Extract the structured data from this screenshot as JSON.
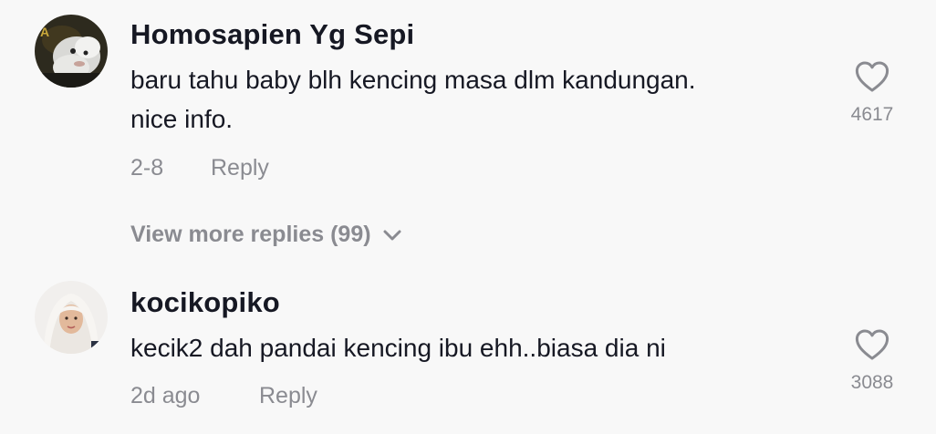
{
  "comments": [
    {
      "username": "Homosapien Yg Sepi",
      "text_lines": [
        "baru tahu baby blh kencing masa dlm kandungan.",
        "nice info."
      ],
      "date": "2-8",
      "reply_label": "Reply",
      "like_count": "4617",
      "avatar_icon": "cat-avatar"
    },
    {
      "username": "kocikopiko",
      "text_lines": [
        "kecik2 dah pandai kencing ibu ehh..biasa dia ni"
      ],
      "date": "2d ago",
      "reply_label": "Reply",
      "like_count": "3088",
      "avatar_icon": "hijab-woman-avatar"
    }
  ],
  "view_more_replies": {
    "label": "View more replies (99)",
    "icon": "chevron-down-icon"
  },
  "colors": {
    "background": "#f8f8f8",
    "primary_text": "#161823",
    "secondary_text": "#8a8b91"
  }
}
